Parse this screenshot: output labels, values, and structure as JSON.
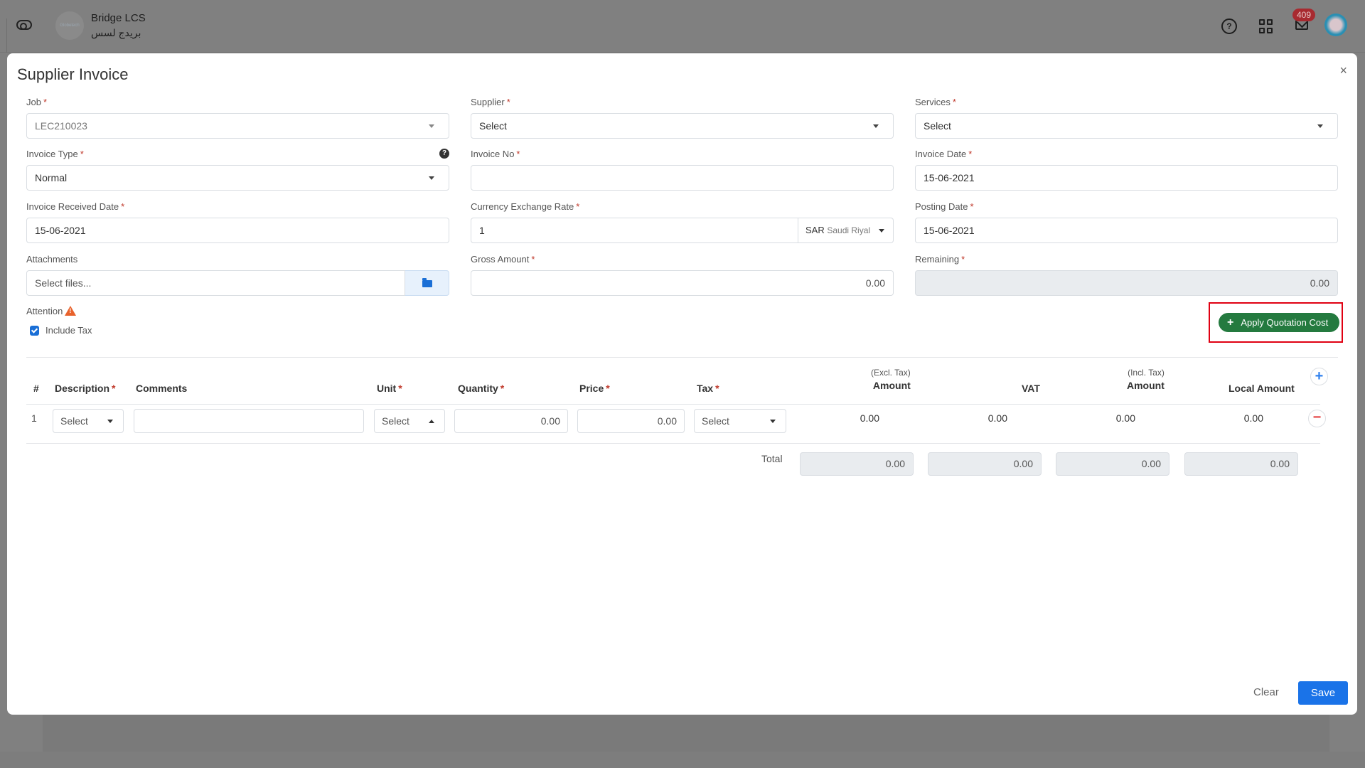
{
  "app_header": {
    "company_name": "Bridge LCS",
    "company_name_ar": "بريدج لسس",
    "logo_text": "Globetech",
    "notification_count": "409",
    "icons": [
      "toggle-icon",
      "help-icon",
      "apps-grid-icon",
      "mail-icon",
      "avatar"
    ]
  },
  "modal": {
    "title": "Supplier Invoice",
    "close_label": "×",
    "fields": {
      "job": {
        "label": "Job",
        "value": "LEC210023",
        "required": true
      },
      "supplier": {
        "label": "Supplier",
        "value": "Select",
        "required": true
      },
      "services": {
        "label": "Services",
        "value": "Select",
        "required": true
      },
      "invoice_type": {
        "label": "Invoice Type",
        "value": "Normal",
        "required": true,
        "help": "?"
      },
      "invoice_no": {
        "label": "Invoice No",
        "value": "",
        "required": true
      },
      "invoice_date": {
        "label": "Invoice Date",
        "value": "15-06-2021",
        "required": true
      },
      "invoice_received_date": {
        "label": "Invoice Received Date",
        "value": "15-06-2021",
        "required": true
      },
      "currency_exchange_rate": {
        "label": "Currency Exchange Rate",
        "value": "1",
        "required": true,
        "currency_code": "SAR",
        "currency_name": "Saudi Riyal"
      },
      "posting_date": {
        "label": "Posting Date",
        "value": "15-06-2021",
        "required": true
      },
      "attachments": {
        "label": "Attachments",
        "placeholder": "Select files..."
      },
      "gross_amount": {
        "label": "Gross Amount",
        "value": "0.00",
        "required": true
      },
      "remaining": {
        "label": "Remaining",
        "value": "0.00",
        "required": true
      }
    },
    "attention_label": "Attention",
    "include_tax": {
      "label": "Include Tax",
      "checked": true
    },
    "apply_quotation_cost_label": "Apply Quotation Cost",
    "table": {
      "headers": {
        "index": "#",
        "description": "Description",
        "comments": "Comments",
        "unit": "Unit",
        "quantity": "Quantity",
        "price": "Price",
        "tax": "Tax",
        "amount_excl_sub": "(Excl. Tax)",
        "amount_excl": "Amount",
        "vat": "VAT",
        "amount_incl_sub": "(Incl. Tax)",
        "amount_incl": "Amount",
        "local_amount": "Local Amount"
      },
      "rows": [
        {
          "index": "1",
          "description": "Select",
          "comments": "",
          "unit": "Select",
          "quantity": "0.00",
          "price": "0.00",
          "tax": "Select",
          "amount_excl": "0.00",
          "vat": "0.00",
          "amount_incl": "0.00",
          "local_amount": "0.00"
        }
      ],
      "totals": {
        "label": "Total",
        "amount_excl": "0.00",
        "vat": "0.00",
        "amount_incl": "0.00",
        "local_amount": "0.00"
      }
    },
    "footer": {
      "clear_label": "Clear",
      "save_label": "Save"
    }
  },
  "colors": {
    "primary": "#1a73e8",
    "success": "#247a3f",
    "required": "#c0392b",
    "highlight": "#e00012",
    "badge": "#a82a30"
  }
}
